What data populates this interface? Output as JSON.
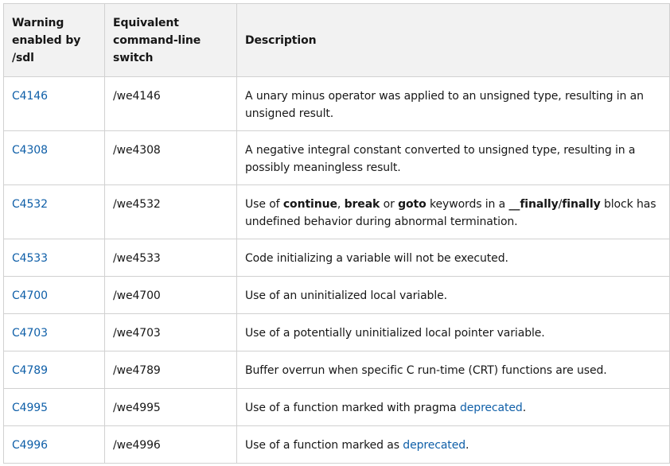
{
  "headers": {
    "warning": "Warning enabled by /sdl",
    "switch": "Equivalent command-line switch",
    "description": "Description"
  },
  "rows": [
    {
      "warning": "C4146",
      "switch": "/we4146",
      "description": "A unary minus operator was applied to an unsigned type, resulting in an unsigned result."
    },
    {
      "warning": "C4308",
      "switch": "/we4308",
      "description": "A negative integral constant converted to unsigned type, resulting in a possibly meaningless result."
    },
    {
      "warning": "C4532",
      "switch": "/we4532",
      "desc_parts": {
        "p1": "Use of ",
        "k1": "continue",
        "p2": ", ",
        "k2": "break",
        "p3": " or ",
        "k3": "goto",
        "p4": " keywords in a ",
        "k4": "__finally",
        "p5": "/",
        "k5": "finally",
        "p6": " block has undefined behavior during abnormal termination."
      }
    },
    {
      "warning": "C4533",
      "switch": "/we4533",
      "description": "Code initializing a variable will not be executed."
    },
    {
      "warning": "C4700",
      "switch": "/we4700",
      "description": "Use of an uninitialized local variable."
    },
    {
      "warning": "C4703",
      "switch": "/we4703",
      "description": "Use of a potentially uninitialized local pointer variable."
    },
    {
      "warning": "C4789",
      "switch": "/we4789",
      "description": "Buffer overrun when specific C run-time (CRT) functions are used."
    },
    {
      "warning": "C4995",
      "switch": "/we4995",
      "desc_pre": "Use of a function marked with pragma ",
      "desc_link": "deprecated",
      "desc_post": "."
    },
    {
      "warning": "C4996",
      "switch": "/we4996",
      "desc_pre": "Use of a function marked as ",
      "desc_link": "deprecated",
      "desc_post": "."
    }
  ],
  "colors": {
    "link": "#0f5fa8",
    "header_bg": "#f2f2f2",
    "border": "#d1d1d1"
  }
}
